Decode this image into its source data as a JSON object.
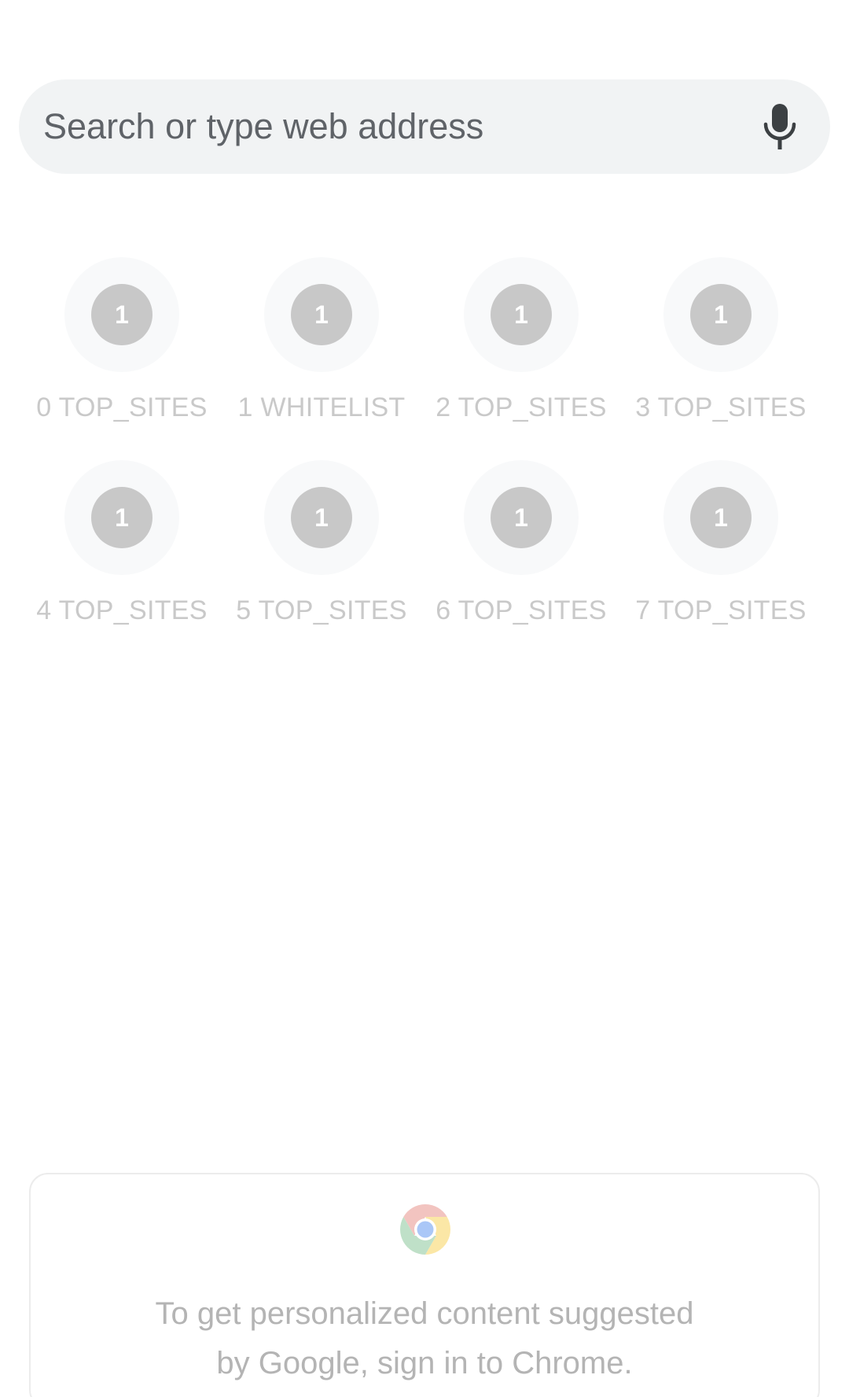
{
  "search": {
    "placeholder": "Search or type web address",
    "mic_icon": "mic-icon"
  },
  "tiles": [
    {
      "icon_text": "1",
      "label": "0 TOP_SITES"
    },
    {
      "icon_text": "1",
      "label": "1 WHITELIST"
    },
    {
      "icon_text": "1",
      "label": "2 TOP_SITES"
    },
    {
      "icon_text": "1",
      "label": "3 TOP_SITES"
    },
    {
      "icon_text": "1",
      "label": "4 TOP_SITES"
    },
    {
      "icon_text": "1",
      "label": "5 TOP_SITES"
    },
    {
      "icon_text": "1",
      "label": "6 TOP_SITES"
    },
    {
      "icon_text": "1",
      "label": "7 TOP_SITES"
    }
  ],
  "promo": {
    "logo_icon": "chrome-logo-icon",
    "line1": "To get personalized content suggested",
    "line2": "by Google, sign in to Chrome."
  },
  "colors": {
    "search_bg": "#f1f3f4",
    "tile_icon": "#c8c8c8",
    "tile_label": "#c9c9c9",
    "promo_text": "#b4b4b4"
  }
}
